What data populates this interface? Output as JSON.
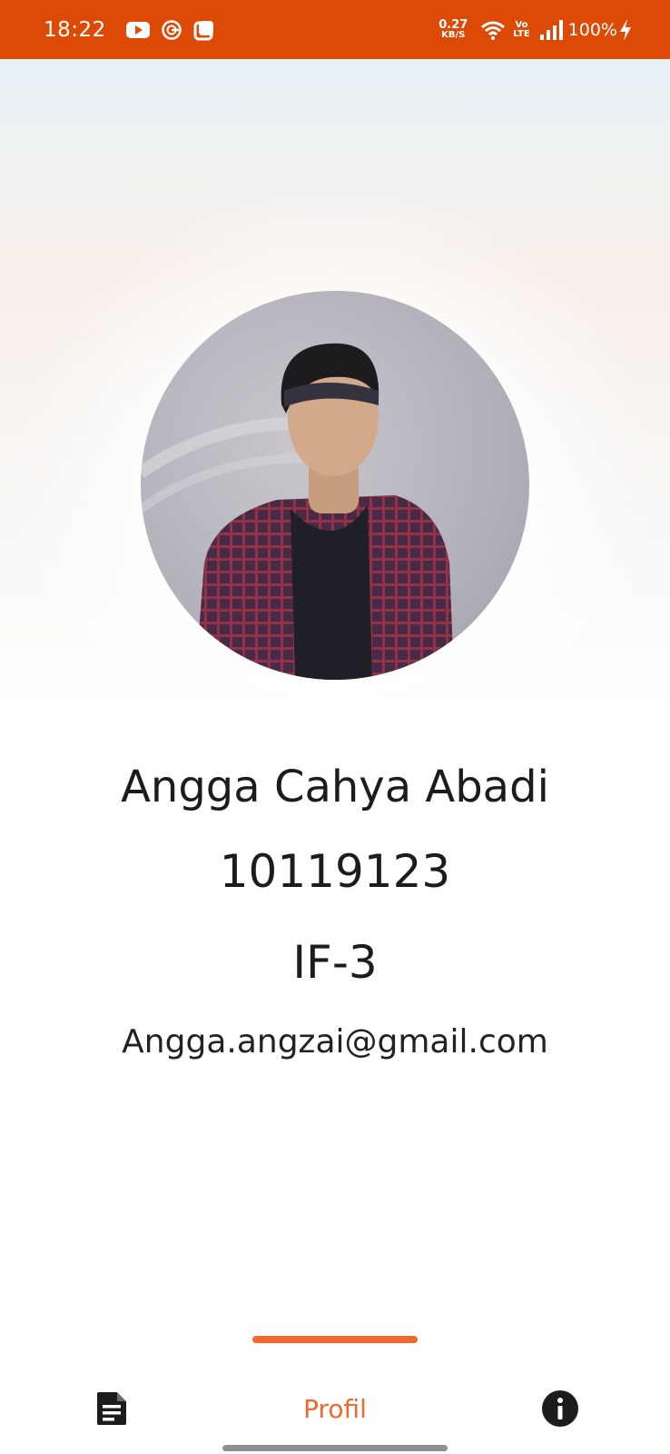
{
  "status_bar": {
    "time": "18:22",
    "net_speed_value": "0.27",
    "net_speed_unit": "KB/S",
    "volte_top": "Vo",
    "volte_bottom": "LTE",
    "battery": "100%",
    "icons": [
      "youtube-icon",
      "g-app-icon",
      "square-app-icon",
      "wifi-icon",
      "signal-icon",
      "charging-icon"
    ],
    "background_color": "#dc4a06"
  },
  "profile": {
    "name": "Angga Cahya Abadi",
    "nim": "10119123",
    "class": "IF-3",
    "email": "Angga.angzai@gmail.com"
  },
  "bottom_nav": {
    "items": [
      {
        "icon": "document-icon"
      },
      {
        "label": "Profil",
        "active": true
      },
      {
        "icon": "info-icon"
      }
    ],
    "accent_color": "#ef6a2c"
  }
}
